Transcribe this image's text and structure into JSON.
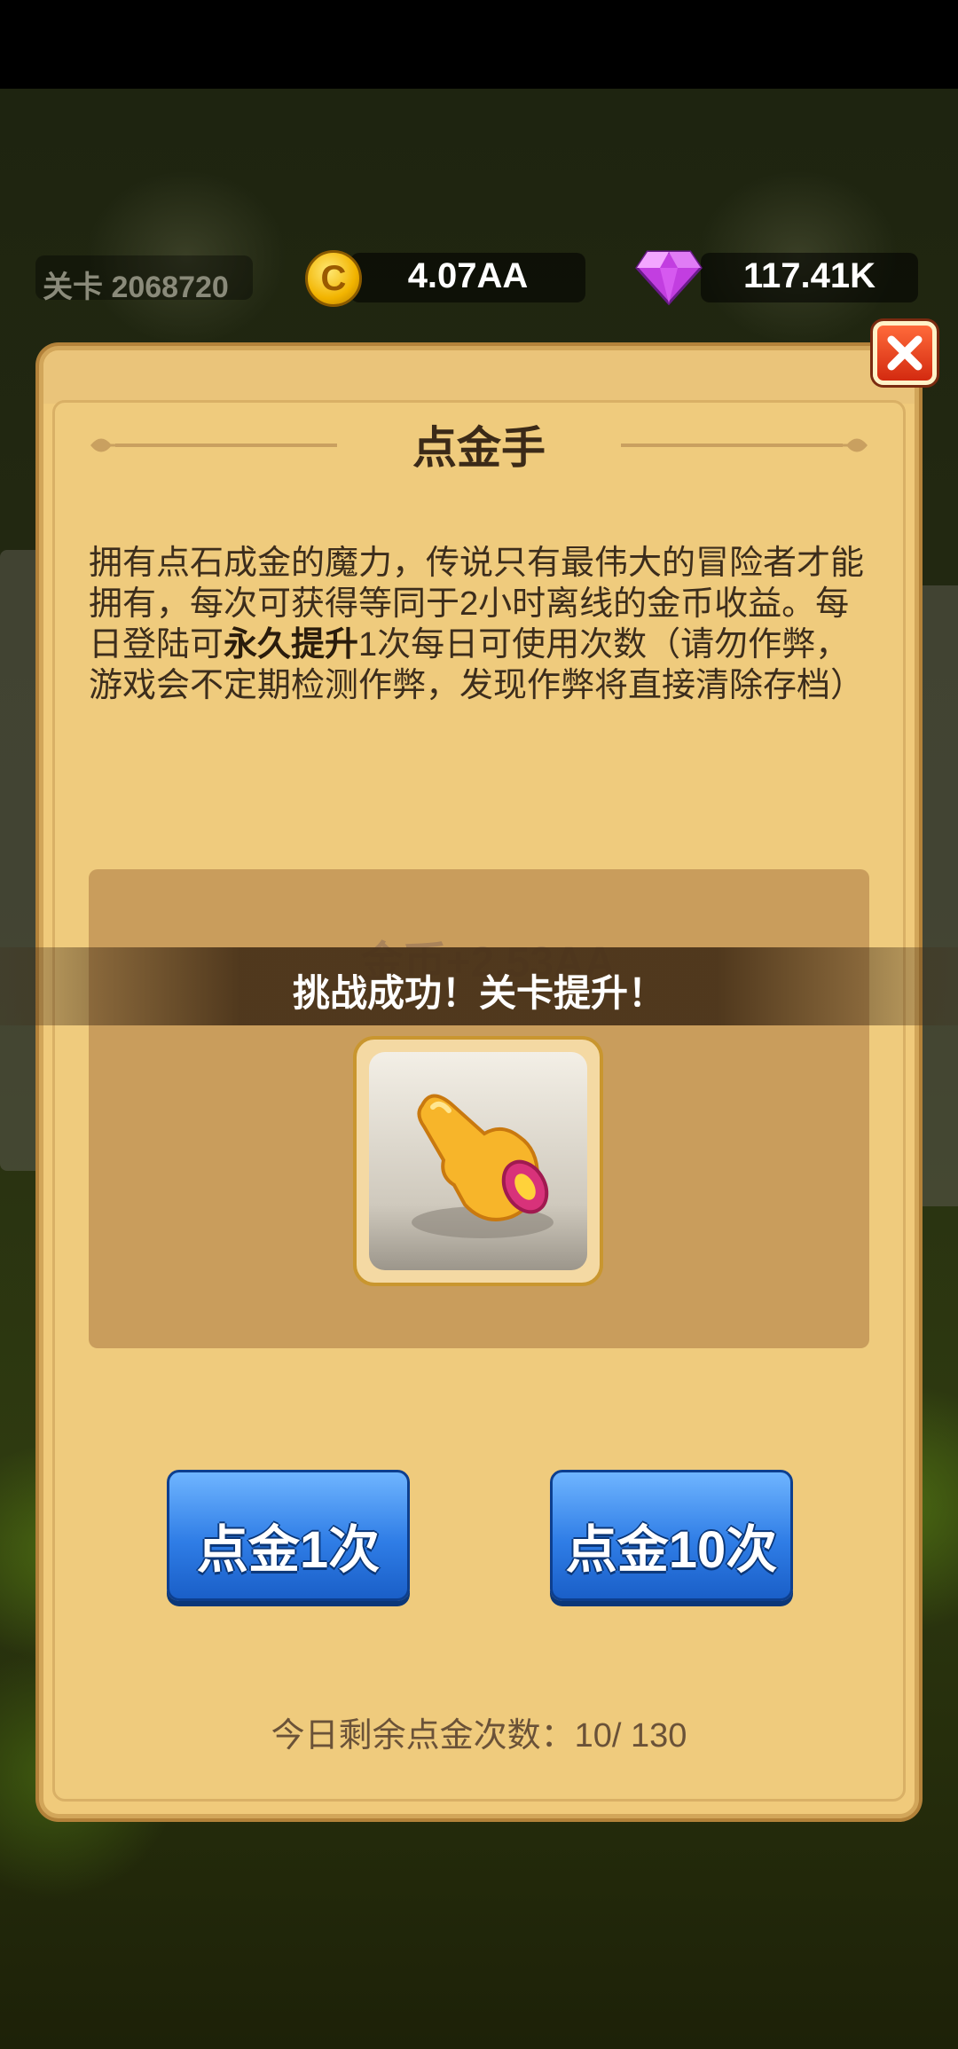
{
  "hud": {
    "level_label": "关卡 2068720",
    "coins": "4.07AA",
    "coin_icon_letter": "C",
    "gems": "117.41K"
  },
  "dialog": {
    "title": "点金手",
    "description_part1": "拥有点石成金的魔力，传说只有最伟大的冒险者才能拥有，每次可获得等同于2小时离线的金币收益。每日登陆可",
    "description_bold": "永久提升",
    "description_part2": "1次每日可使用次数（请勿作弊，游戏会不定期检测作弊，发现作弊将直接清除存档）",
    "reward_text": "金币+2.53AA",
    "item_icon": "golden-pointing-hand-icon",
    "button_once": "点金1次",
    "button_ten": "点金10次",
    "remaining_label": "今日剩余点金次数：",
    "remaining_value": "10/ 130"
  },
  "toast": {
    "message": "挑战成功！关卡提升！"
  },
  "colors": {
    "panel": "#f0ca7b",
    "button_blue": "#2f7de6",
    "close_red": "#d32a10"
  }
}
